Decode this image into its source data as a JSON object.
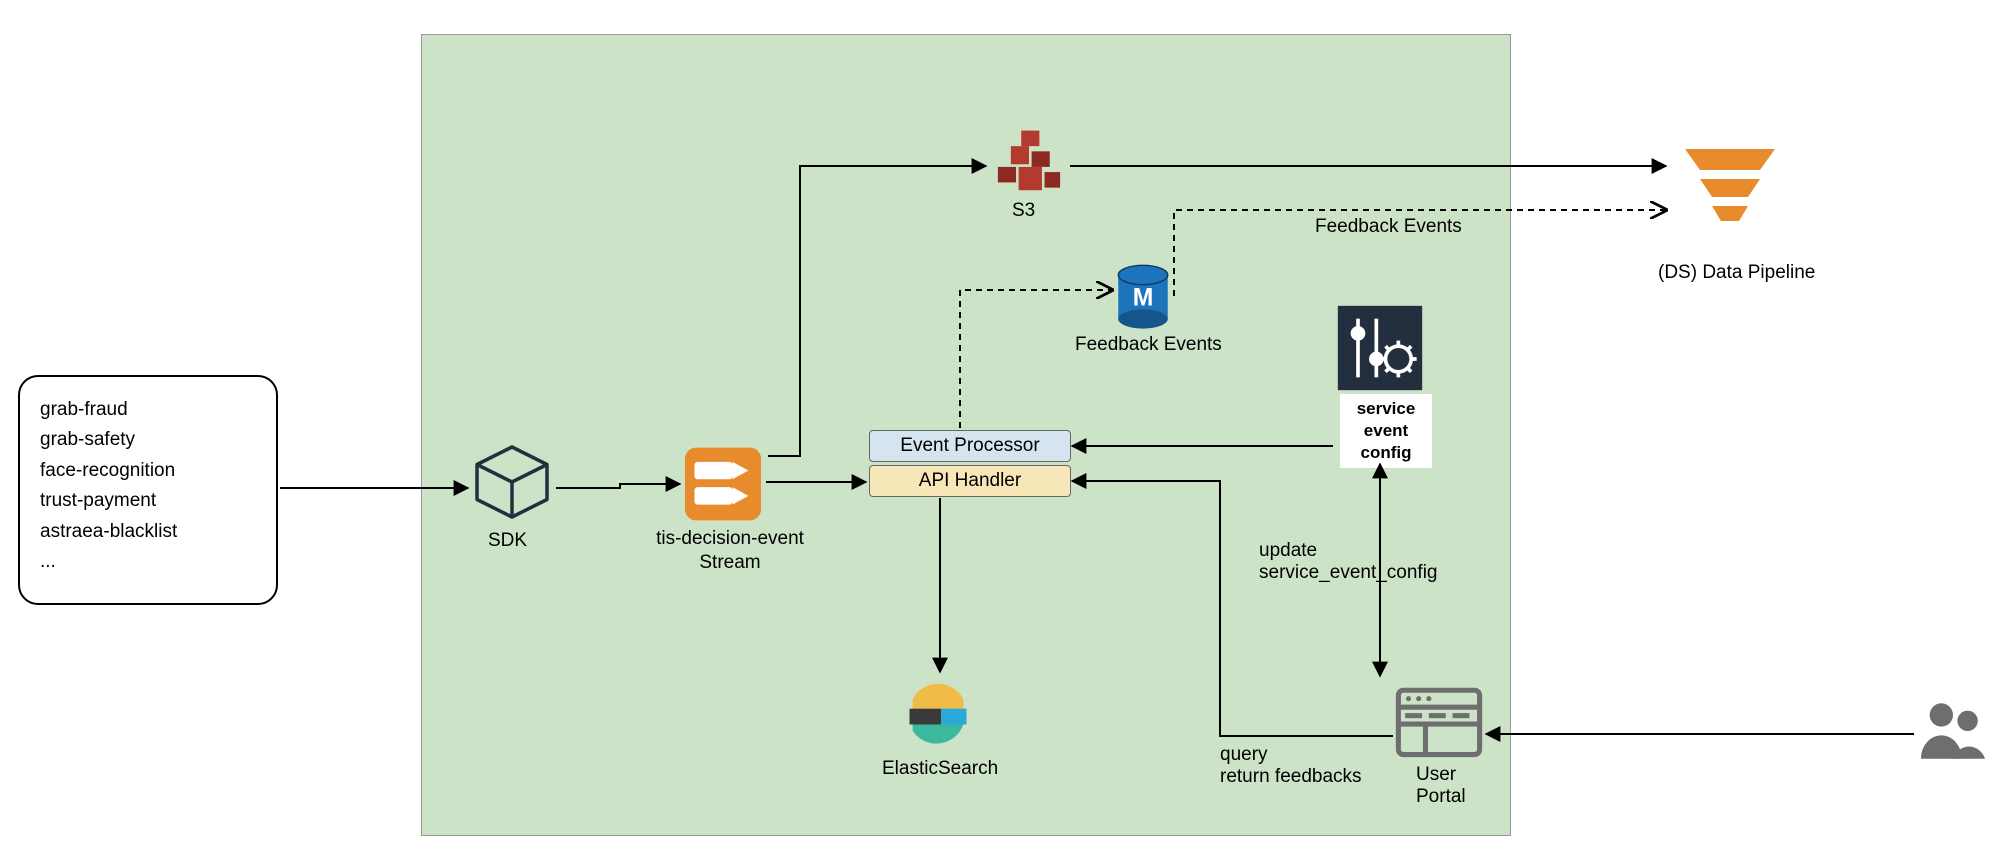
{
  "sources": {
    "items": [
      "grab-fraud",
      "grab-safety",
      "face-recognition",
      "trust-payment",
      "astraea-blacklist",
      "..."
    ]
  },
  "nodes": {
    "sdk": "SDK",
    "stream_l1": "tis-decision-event",
    "stream_l2": "Stream",
    "s3": "S3",
    "feedback_db": "Feedback Events",
    "event_processor": "Event Processor",
    "api_handler": "API Handler",
    "elastic": "ElasticSearch",
    "config_l1": "service",
    "config_l2": "event",
    "config_l3": "config",
    "portal_l1": "User",
    "portal_l2": "Portal",
    "pipeline": "(DS) Data Pipeline"
  },
  "edges": {
    "feedback_events_out": "Feedback Events",
    "update_l1": "update",
    "update_l2": "service_event_config",
    "query_l1": "query",
    "query_l2": "return feedbacks"
  },
  "colors": {
    "panel": "#cde3c7",
    "orange": "#e88b2d",
    "red": "#b33a2f",
    "blue": "#1c75bc",
    "dark": "#232f3e",
    "gray": "#6e6e6e"
  }
}
